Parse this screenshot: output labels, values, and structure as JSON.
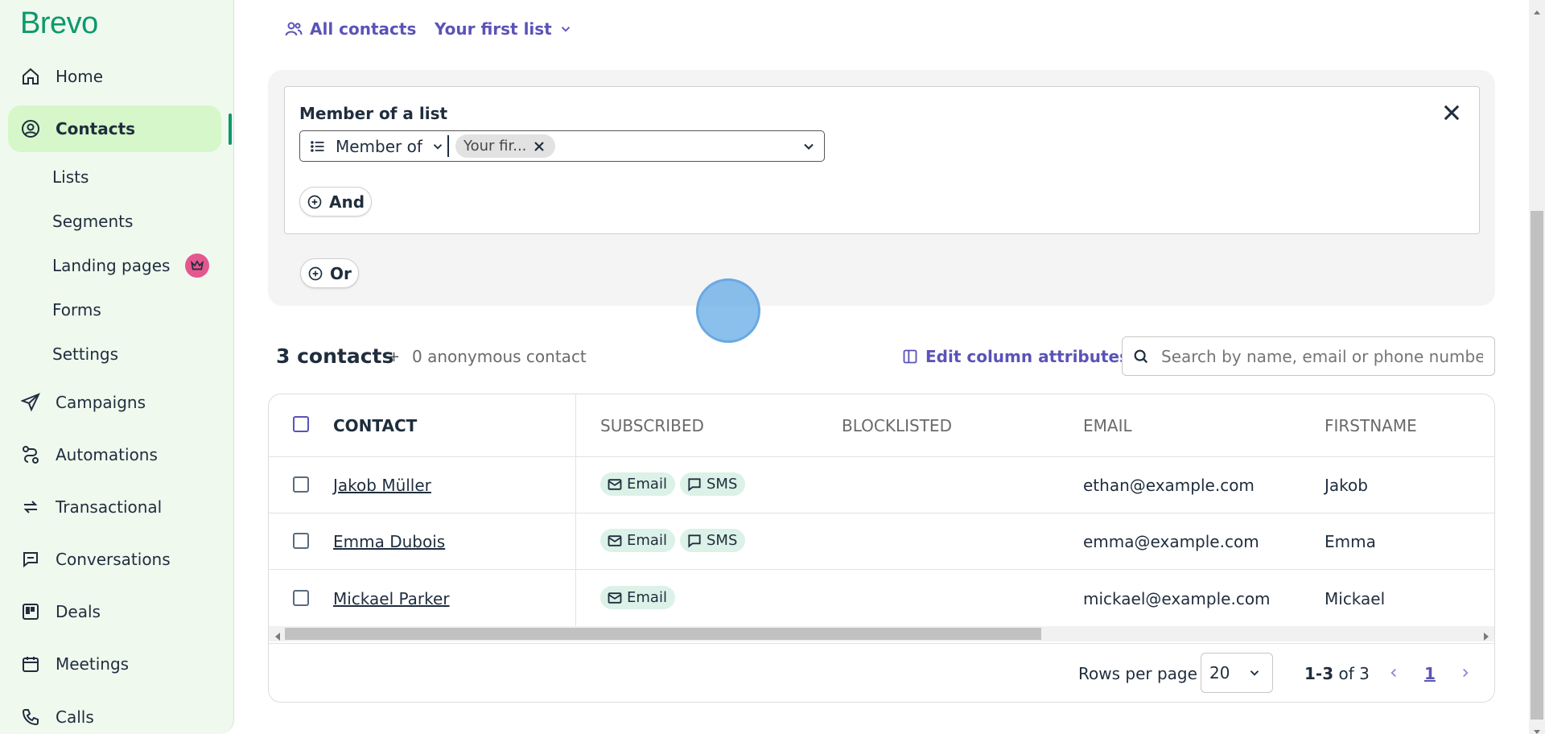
{
  "sidebar": {
    "logo": "Brevo",
    "nav": [
      {
        "label": "Home",
        "icon": "home-icon"
      },
      {
        "label": "Contacts",
        "icon": "contacts-icon",
        "active": true
      },
      {
        "label": "Campaigns",
        "icon": "send-icon"
      },
      {
        "label": "Automations",
        "icon": "automation-icon"
      },
      {
        "label": "Transactional",
        "icon": "transactional-icon"
      },
      {
        "label": "Conversations",
        "icon": "chat-icon"
      },
      {
        "label": "Deals",
        "icon": "deals-icon"
      },
      {
        "label": "Meetings",
        "icon": "calendar-icon"
      },
      {
        "label": "Calls",
        "icon": "phone-icon"
      }
    ],
    "sub_items": [
      "Lists",
      "Segments",
      "Landing pages",
      "Forms",
      "Settings"
    ],
    "premium_icon": "crown-icon",
    "colors": {
      "brand": "#0b996e",
      "active_bg": "#d5f7c9",
      "premium": "#e5578f"
    }
  },
  "top_nav": {
    "all_contacts": "All contacts",
    "list_selector": "Your first list"
  },
  "filter": {
    "title": "Member of a list",
    "operator": "Member of",
    "chip": "Your fir...",
    "and_label": "And",
    "or_label": "Or"
  },
  "contacts": {
    "count_label": "3 contacts",
    "plus": "+",
    "anonymous": "0 anonymous contact",
    "edit_columns": "Edit column attributes",
    "search_placeholder": "Search by name, email or phone number"
  },
  "table": {
    "headers": [
      "CONTACT",
      "SUBSCRIBED",
      "BLOCKLISTED",
      "EMAIL",
      "FIRSTNAME"
    ],
    "rows": [
      {
        "name": "Jakob Müller",
        "subscribed": [
          "Email",
          "SMS"
        ],
        "email": "ethan@example.com",
        "firstname": "Jakob"
      },
      {
        "name": "Emma Dubois",
        "subscribed": [
          "Email",
          "SMS"
        ],
        "email": "emma@example.com",
        "firstname": "Emma"
      },
      {
        "name": "Mickael Parker",
        "subscribed": [
          "Email"
        ],
        "email": "mickael@example.com",
        "firstname": "Mickael"
      }
    ]
  },
  "pagination": {
    "rows_per_page_label": "Rows per page",
    "rows_per_page": "20",
    "range_bold": "1-3",
    "range_rest": " of 3",
    "current_page": "1"
  },
  "accent_color": "#5b53b7"
}
